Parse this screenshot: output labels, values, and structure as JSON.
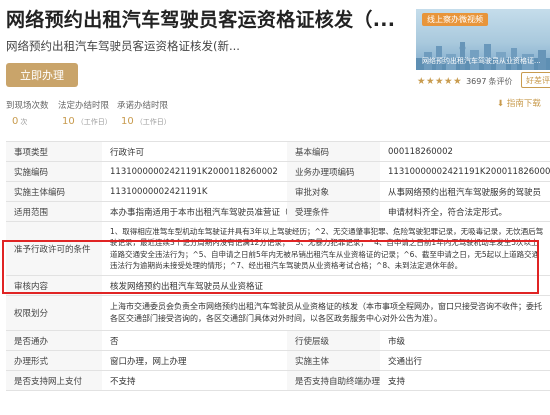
{
  "header": {
    "title": "网络预约出租汽车驾驶员客运资格证核发（...",
    "subtitle": "网络预约出租汽车驾驶员客运资格证核发(新...",
    "apply_label": "立即办理"
  },
  "stats": [
    {
      "label": "到现场次数",
      "value": "0",
      "unit": "次"
    },
    {
      "label": "法定办结时限",
      "value": "10",
      "unit": "（工作日）"
    },
    {
      "label": "承诺办结时限",
      "value": "10",
      "unit": "（工作日）"
    }
  ],
  "video": {
    "badge": "线上察办微视频",
    "caption": "网络预约出租汽车驾驶员从业资格证..."
  },
  "rating": {
    "stars": "★★★★★",
    "count": "3697",
    "count_label": "条评价",
    "review_label": "好差评"
  },
  "guide_label": "指南下载",
  "table": {
    "row1": {
      "k1": "事项类型",
      "v1": "行政许可",
      "k2": "基本编码",
      "v2": "000118260002"
    },
    "row2": {
      "k1": "实施编码",
      "v1": "11310000002421191K2000118260002",
      "k2": "业务办理项编码",
      "v2": "11310000002421191K200011826000 2A1"
    },
    "row3": {
      "k1": "实施主体编码",
      "v1": "11310000002421191K",
      "k2": "审批对象",
      "v2": "从事网络预约出租汽车驾驶服务的驾驶员"
    },
    "row4": {
      "k1": "适用范围",
      "v1": "本办事指南适用于本市出租汽车驾驶员准营证（从业...",
      "k2": "受理条件",
      "v2": "申请材料齐全，符合法定形式。"
    },
    "row5": {
      "k1": "准予行政许可的条件",
      "v1": "1、取得相应准驾车型机动车驾驶证并具有3年以上驾驶经历；^2、无交通肇事犯罪、危险驾驶犯罪记录，无吸毒记录，无饮酒后驾驶记录，最近连续3个记分周期内没有记满12分记录；^3、无暴力犯罪记录；^4、自申请之日前1年内无驾驶机动车发生5次以上道路交通安全违法行为；^5、自申请之日前5年内无被吊销出租汽车从业资格证的记录；^6、截至申请之日，无5起以上道路交通违法行为逾期尚未接受处理的情形；^7、经出租汽车驾驶员从业资格考试合格；^8、未到法定退休年龄。"
    },
    "row6": {
      "k1": "审核内容",
      "v1": "核发网络预约出租汽车驾驶员从业资格证"
    },
    "row7": {
      "k1": "权限划分",
      "v1": "上海市交通委员会负责全市网络预约出租汽车驾驶员从业资格证的核发（本市事项全程网办，窗口只接受咨询不收件；委托各区交通部门接受咨询的，各区交通部门具体对外时间，以各区政务服务中心对外公告为准）。"
    },
    "row8": {
      "k1": "是否通办",
      "v1": "否",
      "k2": "行使层级",
      "v2": "市级"
    },
    "row9": {
      "k1": "办理形式",
      "v1": "窗口办理，网上办理",
      "k2": "实施主体",
      "v2": "交通出行"
    },
    "row10": {
      "k1": "是否支持网上支付",
      "v1": "不支持",
      "k2": "是否支持自助终端办理",
      "v2": "支持"
    }
  },
  "colors": {
    "accent": "#c89b4e",
    "button": "#c9a46a",
    "highlight": "#e02424"
  }
}
